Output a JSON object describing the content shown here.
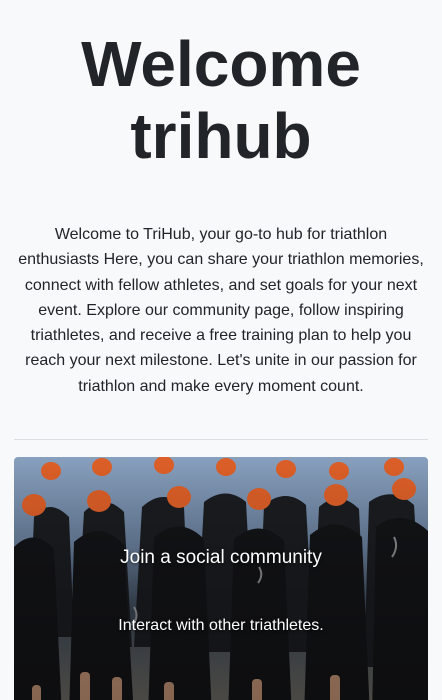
{
  "hero": {
    "title_line1": "Welcome",
    "title_line2": "trihub"
  },
  "intro": {
    "text": "Welcome to TriHub, your go-to hub for triathlon enthusiasts Here, you can share your triathlon memories, connect with fellow athletes, and set goals for your next event. Explore our community page, follow inspiring triathletes, and receive a free training plan to help you reach your next milestone. Let's unite in our passion for triathlon and make every moment count."
  },
  "feature": {
    "heading": "Join a social community",
    "text": "Interact with other triathletes.",
    "image": "triathlon-swimmers-photo"
  },
  "colors": {
    "background": "#f8f9fa",
    "text": "#212529",
    "cap_orange": "#e8642a",
    "overlay_text": "#ffffff"
  }
}
